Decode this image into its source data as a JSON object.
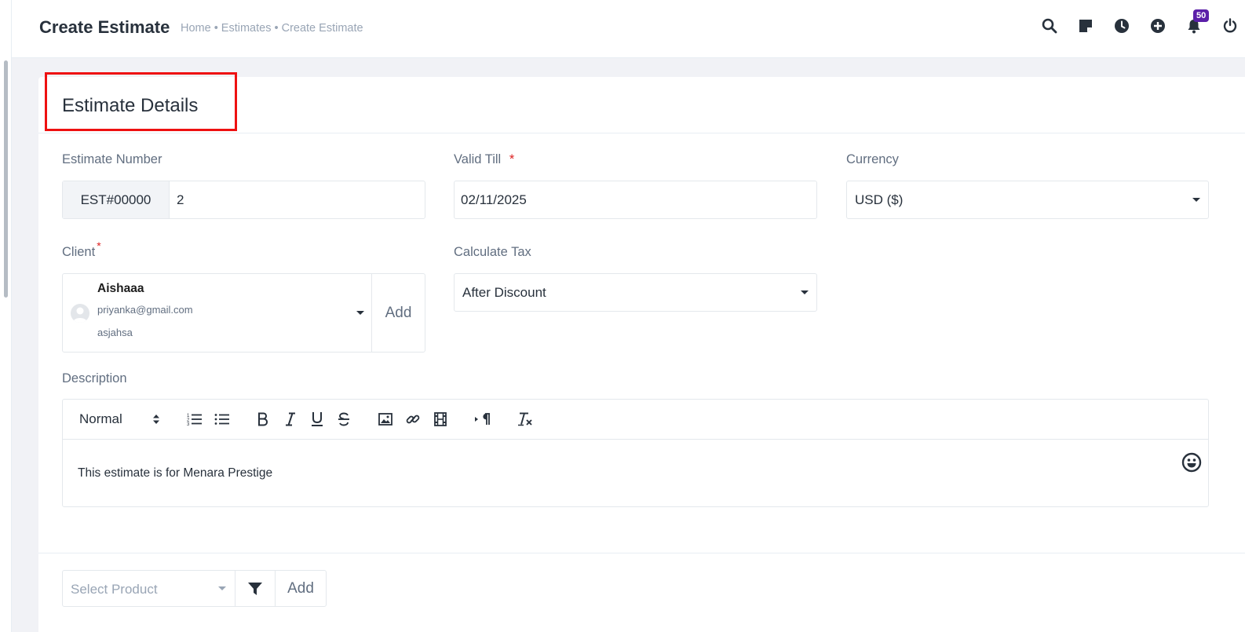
{
  "header": {
    "title": "Create Estimate",
    "breadcrumb": "Home • Estimates • Create Estimate",
    "notification_count": "50",
    "icons": [
      "search-icon",
      "sticky-note-icon",
      "clock-icon",
      "plus-circle-icon",
      "bell-icon",
      "power-icon"
    ]
  },
  "card": {
    "title": "Estimate Details"
  },
  "form": {
    "estimate_number": {
      "label": "Estimate Number",
      "prefix": "EST#00000",
      "value": "2"
    },
    "valid_till": {
      "label": "Valid Till",
      "required_mark": "*",
      "value": "02/11/2025"
    },
    "currency": {
      "label": "Currency",
      "value": "USD ($)"
    },
    "client": {
      "label": "Client",
      "required_mark": "*",
      "name": "Aishaaa",
      "email": "priyanka@gmail.com",
      "company": "asjahsa",
      "add_label": "Add"
    },
    "calculate_tax": {
      "label": "Calculate Tax",
      "value": "After Discount"
    },
    "description": {
      "label": "Description",
      "format_value": "Normal",
      "text": "This estimate is for Menara Prestige"
    }
  },
  "product": {
    "placeholder": "Select Product",
    "add_label": "Add"
  },
  "colors": {
    "accent": "#5b1fa8",
    "required": "#dd2222",
    "highlight": "#ee1111"
  }
}
